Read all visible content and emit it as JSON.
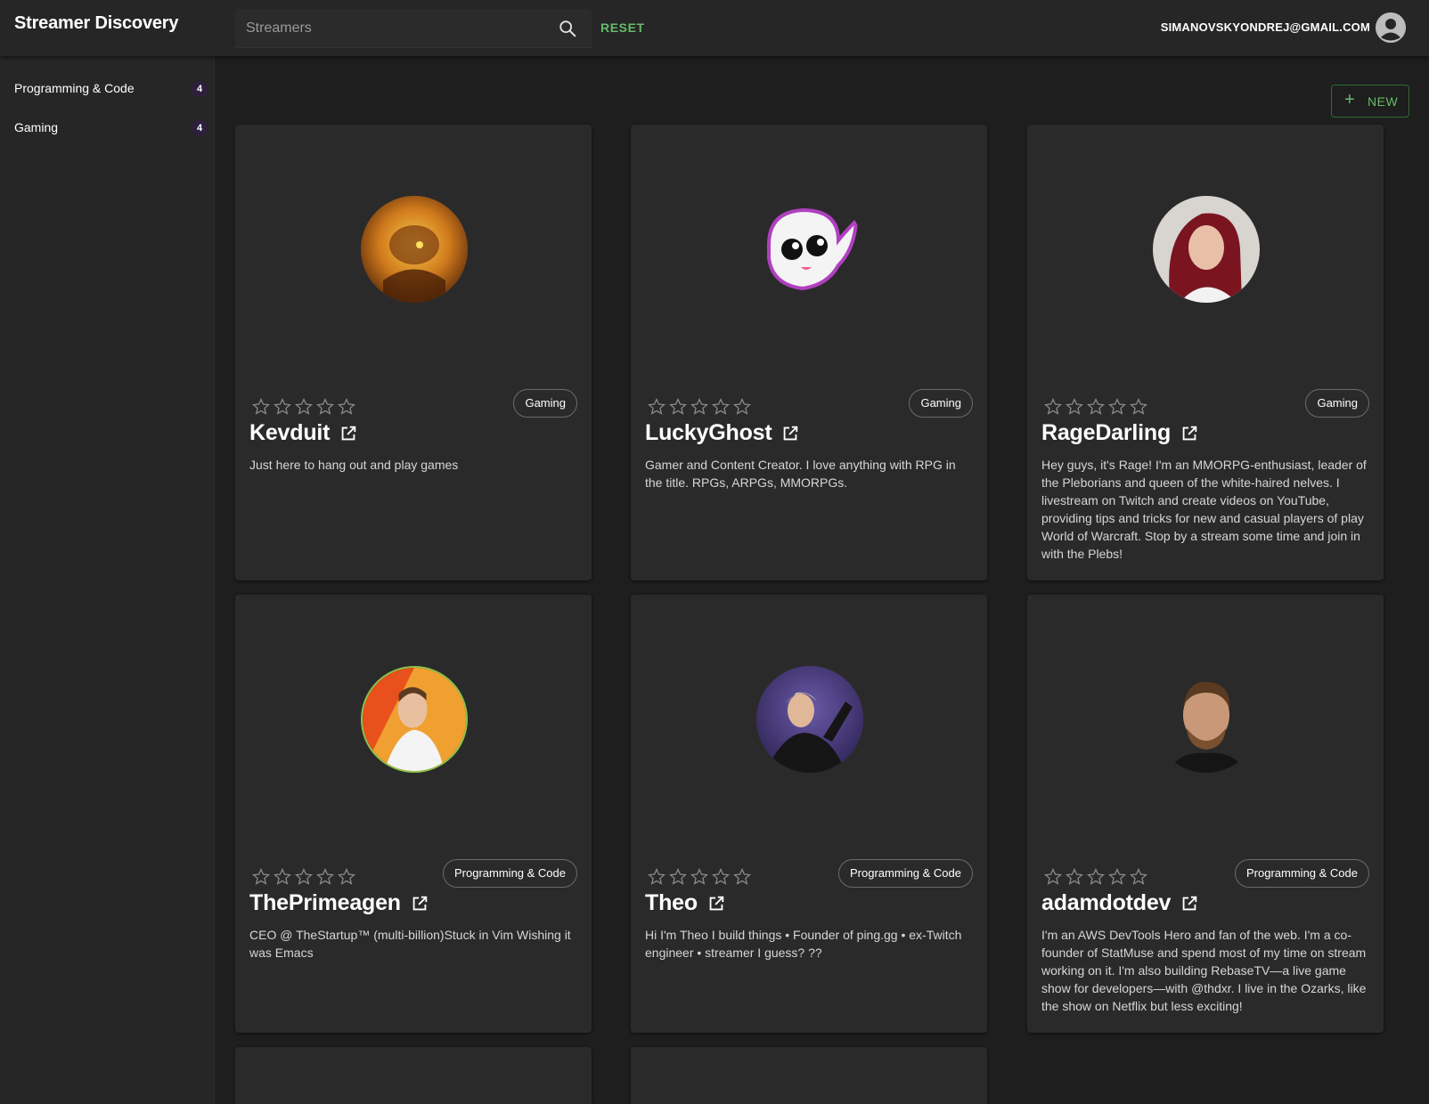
{
  "app": {
    "title": "Streamer Discovery"
  },
  "header": {
    "search_placeholder": "Streamers",
    "search_value": "",
    "reset_label": "RESET",
    "user_email": "SIMANOVSKYONDREJ@GMAIL.COM"
  },
  "sidebar": {
    "items": [
      {
        "label": "Programming & Code",
        "count": "4"
      },
      {
        "label": "Gaming",
        "count": "4"
      }
    ]
  },
  "toolbar": {
    "new_label": "NEW",
    "new_icon": "plus-icon"
  },
  "colors": {
    "accent": "#66bb6a",
    "background": "#1e1e1e",
    "card": "#2a2a2a",
    "badge": "#2d1f3d"
  },
  "cards": [
    {
      "name": "Kevduit",
      "category": "Gaming",
      "rating": 0,
      "description": "Just here to hang out and play games"
    },
    {
      "name": "LuckyGhost",
      "category": "Gaming",
      "rating": 0,
      "description": "Gamer and Content Creator. I love anything with RPG in the title. RPGs, ARPGs, MMORPGs."
    },
    {
      "name": "RageDarling",
      "category": "Gaming",
      "rating": 0,
      "description": "Hey guys, it's Rage! I'm an MMORPG-enthusiast, leader of the Pleborians and queen of the white-haired nelves. I livestream on Twitch and create videos on YouTube, providing tips and tricks for new and casual players of play World of Warcraft. Stop by a stream some time and join in with the Plebs!"
    },
    {
      "name": "ThePrimeagen",
      "category": "Programming & Code",
      "rating": 0,
      "description": "CEO @ TheStartup™ (multi-billion)Stuck in Vim Wishing it was Emacs"
    },
    {
      "name": "Theo",
      "category": "Programming & Code",
      "rating": 0,
      "description": "Hi I'm Theo I build things • Founder of ping.gg • ex-Twitch engineer • streamer I guess? ??"
    },
    {
      "name": "adamdotdev",
      "category": "Programming & Code",
      "rating": 0,
      "description": "I'm an AWS DevTools Hero and fan of the web. I'm a co-founder of StatMuse and spend most of my time on stream working on it. I'm also building RebaseTV—a live game show for developers—with @thdxr. I live in the Ozarks, like the show on Netflix but less exciting!"
    }
  ]
}
